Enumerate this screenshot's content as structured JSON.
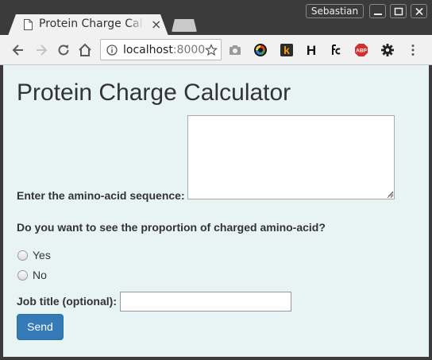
{
  "browser": {
    "tab_title": "Protein Charge Calculator",
    "tab_close": "×",
    "profile_name": "Sebastian",
    "url_host": "localhost",
    "url_port": ":8000",
    "colors": {
      "frame": "#3b3b3b",
      "toolbar": "#f1f1f1",
      "page_bg": "#e8f4f4",
      "primary_button": "#337ab7"
    }
  },
  "toolbar": {
    "icons": [
      "back-icon",
      "forward-icon",
      "reload-icon",
      "home-icon",
      "info-icon",
      "bookmark-star-icon"
    ],
    "extensions": [
      "camera-icon",
      "color-wheel-icon",
      "k-extension-icon",
      "h-extension-icon",
      "fc-extension-icon",
      "adblock-plus-icon",
      "gear-icon",
      "menu-icon"
    ],
    "ext_k": "k",
    "ext_h": "H",
    "ext_abp": "ABP",
    "menu": "⋮"
  },
  "page": {
    "title": "Protein Charge Calculator",
    "sequence_label": "Enter the amino-acid sequence:",
    "sequence_value": "",
    "proportion_question": "Do you want to see the proportion of charged amino-acid?",
    "options": [
      {
        "label": "Yes",
        "checked": false
      },
      {
        "label": "No",
        "checked": false
      }
    ],
    "job_title_label": "Job title (optional):",
    "job_title_value": "",
    "send_label": "Send"
  }
}
